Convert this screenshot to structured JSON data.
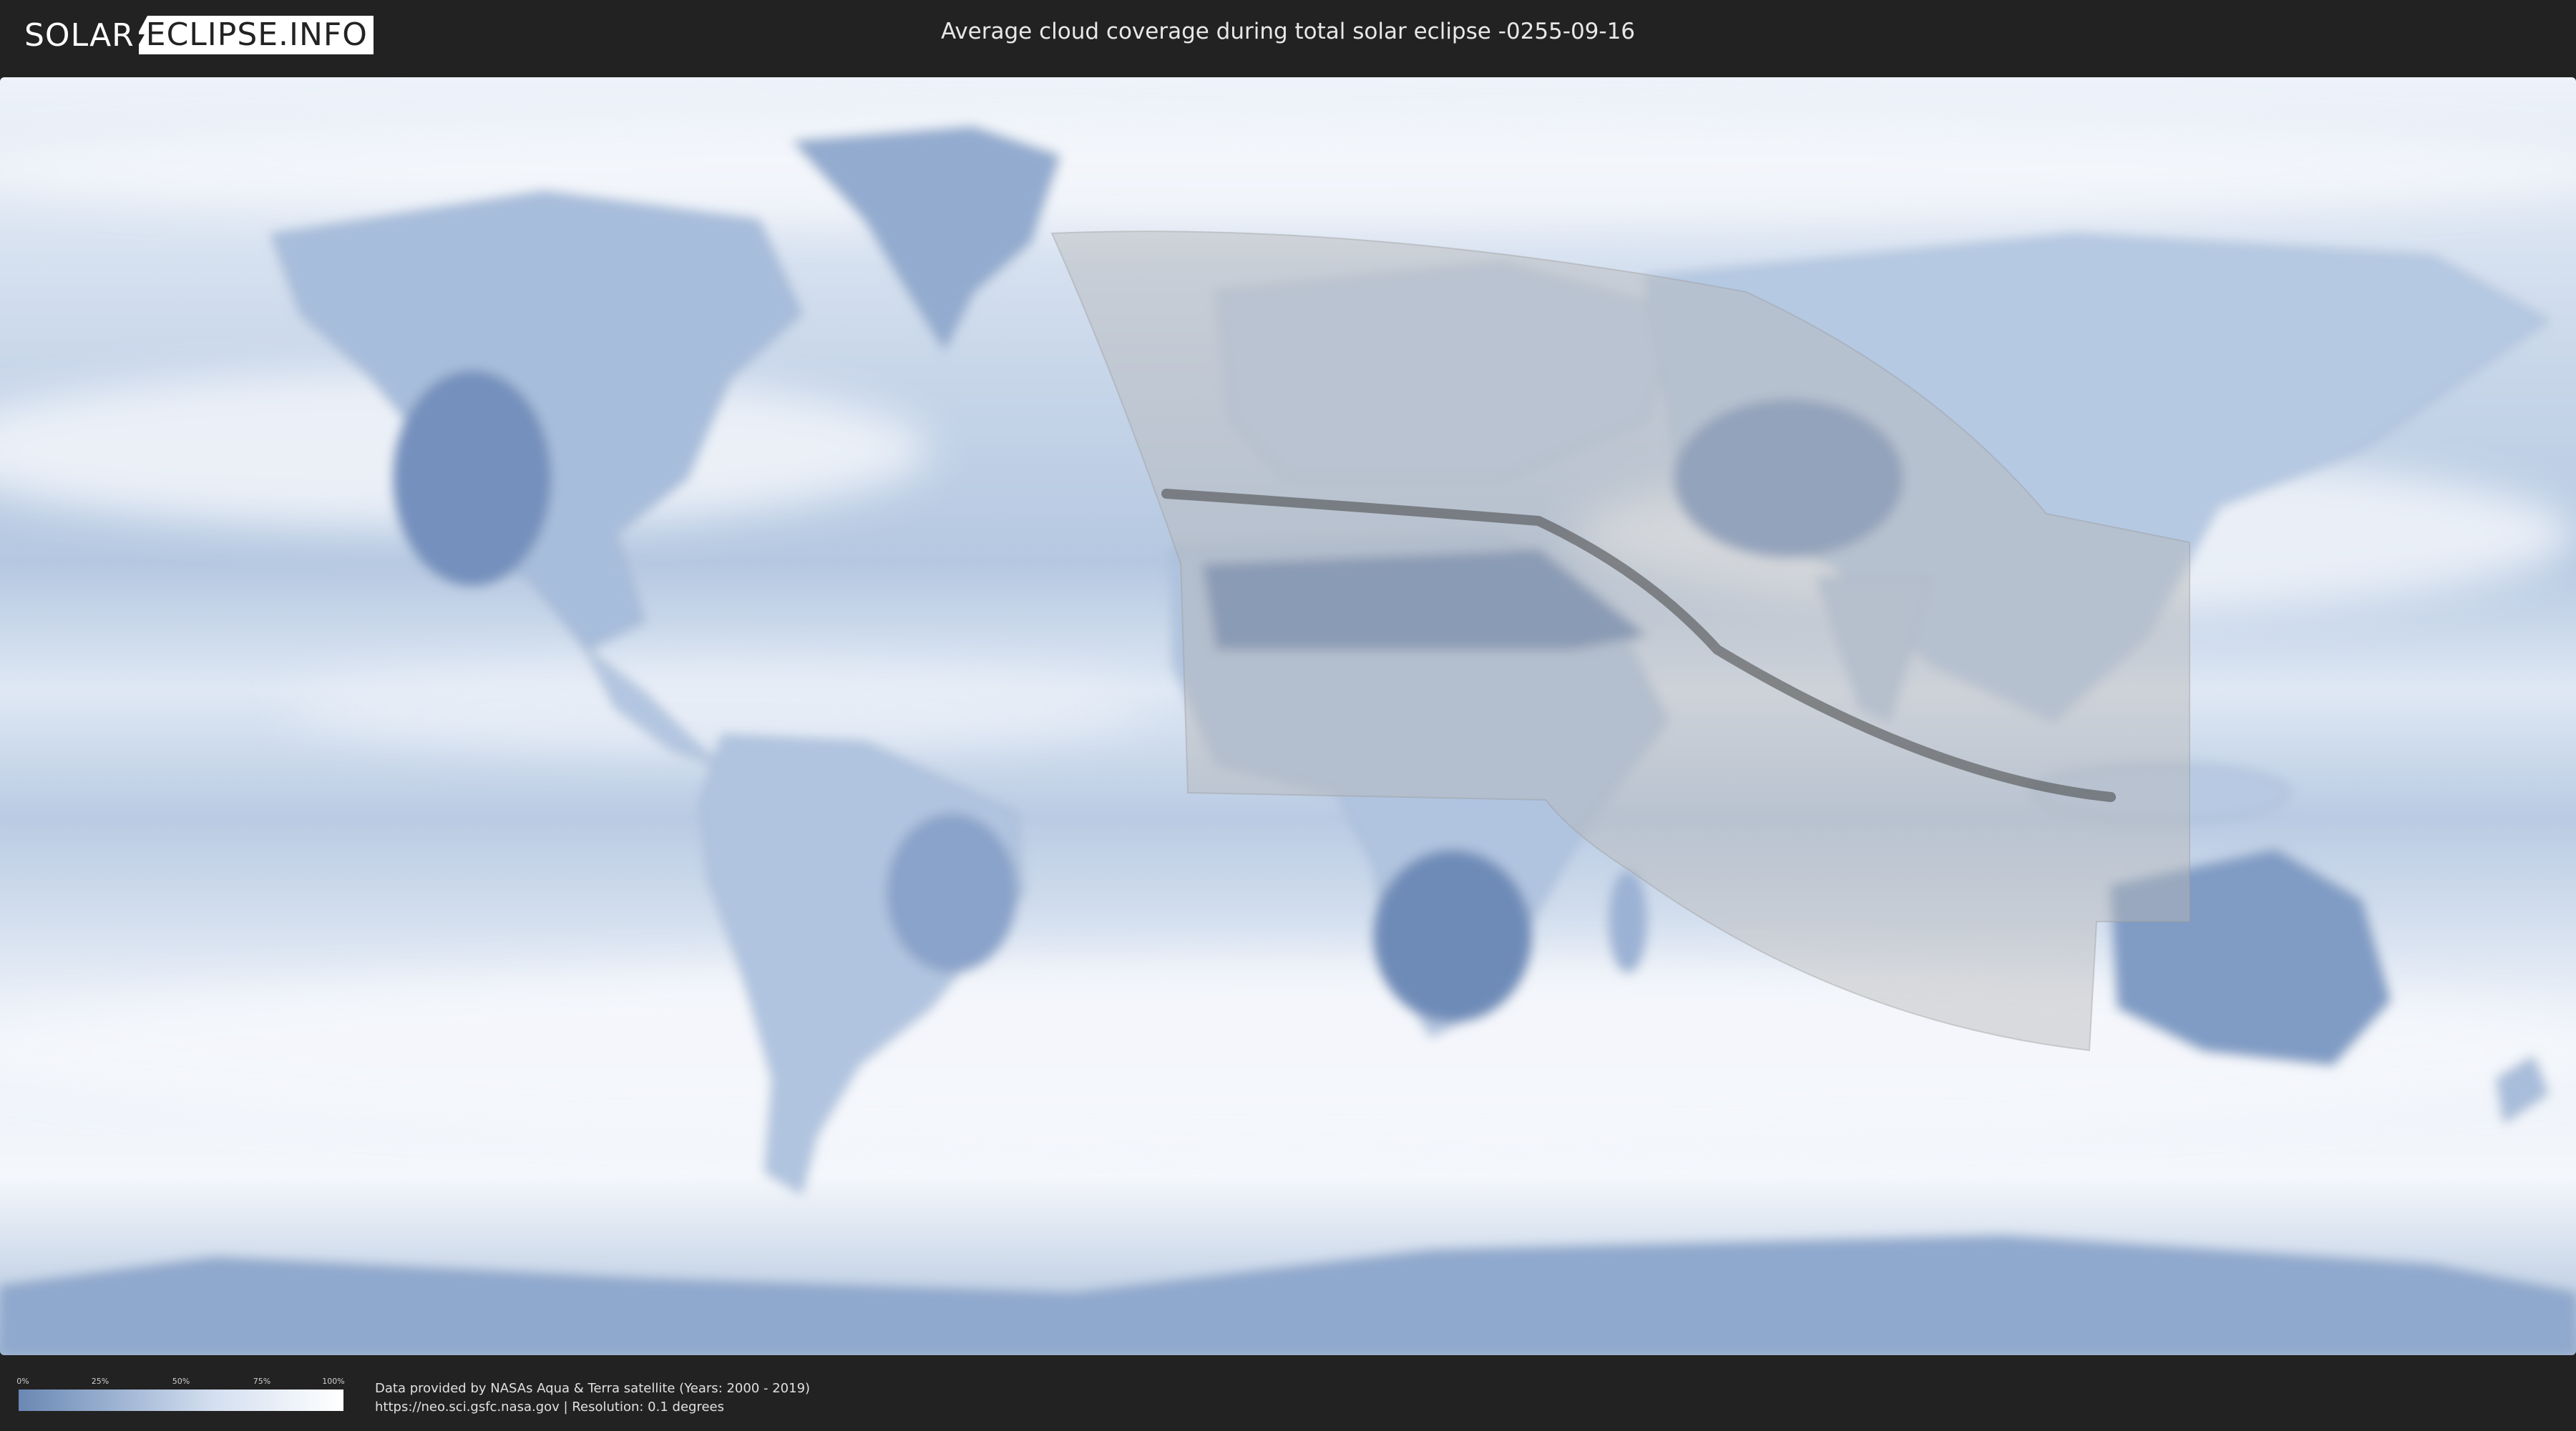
{
  "header": {
    "logo_left": "SOLAR",
    "logo_right": "ECLIPSE.INFO",
    "title": "Average cloud coverage during total solar eclipse -0255-09-16"
  },
  "legend": {
    "ticks": [
      "0%",
      "25%",
      "50%",
      "75%",
      "100%"
    ],
    "colors": {
      "low": "#6a88b4",
      "mid": "#d4dff0",
      "high": "#ffffff"
    }
  },
  "credits": {
    "line1": "Data provided by NASAs Aqua & Terra satellite (Years: 2000 - 2019)",
    "line2": "https://neo.sci.gsfc.nasa.gov | Resolution: 0.1 degrees"
  },
  "map": {
    "icon": "world-map-icon",
    "colors": {
      "cloud": "#eef3fa",
      "clear": "#5f7eae",
      "shadow_zone": "#b8b8b8",
      "totality_path": "#444444"
    }
  }
}
